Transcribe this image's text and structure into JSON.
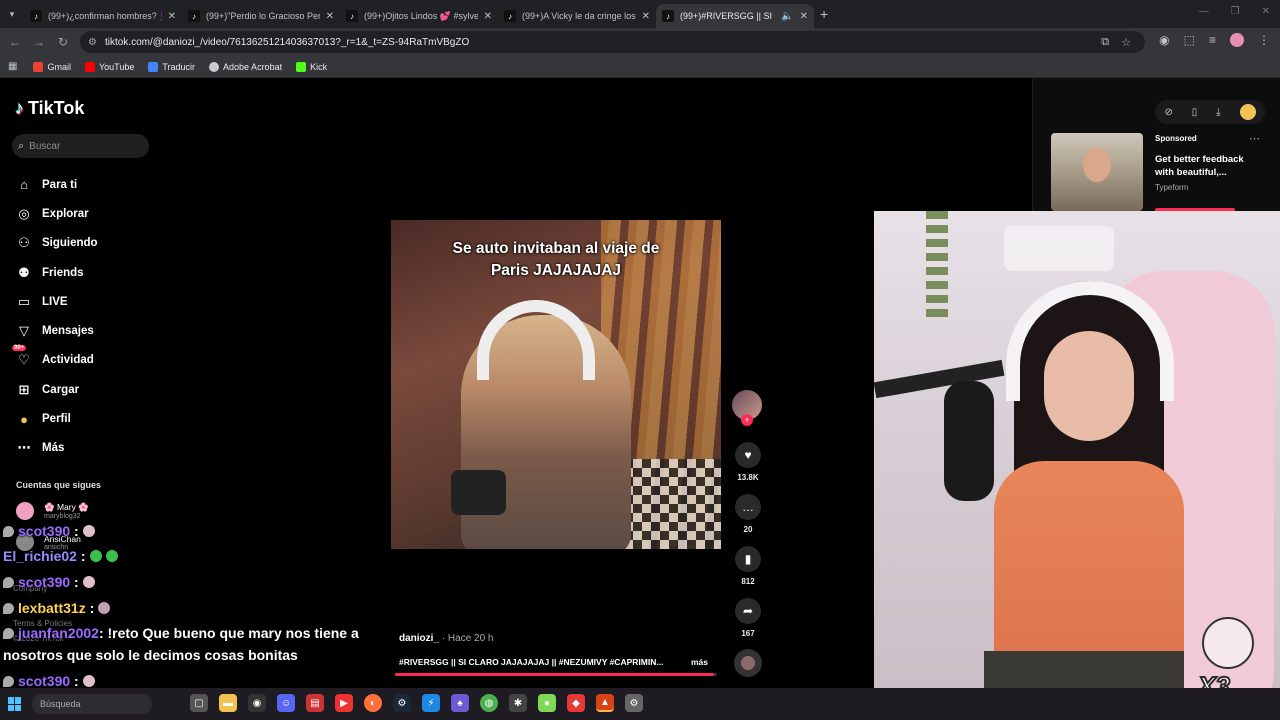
{
  "browser": {
    "tabs": [
      {
        "title": "(99+)¿confirman hombres? 🧕 ..."
      },
      {
        "title": "(99+)\"Perdio lo Gracioso Pero C..."
      },
      {
        "title": "(99+)Ojitos Lindos 💕 #sylvee..."
      },
      {
        "title": "(99+)A Vicky le da cringe los in..."
      },
      {
        "title": "(99+)#RIVERSGG || SI CLARO..."
      }
    ],
    "url": "tiktok.com/@daniozi_/video/7613625121403637013?_r=1&_t=ZS-94RaTmVBgZO",
    "bookmarks": [
      {
        "label": "Gmail",
        "color": "#ea4335"
      },
      {
        "label": "YouTube",
        "color": "#ff0000"
      },
      {
        "label": "Traducir",
        "color": "#4285f4"
      },
      {
        "label": "Adobe Acrobat",
        "color": "#cccccc"
      },
      {
        "label": "Kick",
        "color": "#53fc18"
      }
    ]
  },
  "tiktok": {
    "logo": "TikTok",
    "search_placeholder": "Buscar",
    "menu": [
      {
        "label": "Para ti",
        "icon": "home-icon"
      },
      {
        "label": "Explorar",
        "icon": "compass-icon"
      },
      {
        "label": "Siguiendo",
        "icon": "following-icon"
      },
      {
        "label": "Friends",
        "icon": "friends-icon"
      },
      {
        "label": "LIVE",
        "icon": "live-icon"
      },
      {
        "label": "Mensajes",
        "icon": "messages-icon"
      },
      {
        "label": "Actividad",
        "icon": "activity-icon",
        "badge": "99+"
      },
      {
        "label": "Cargar",
        "icon": "upload-icon"
      },
      {
        "label": "Perfil",
        "icon": "profile-icon"
      },
      {
        "label": "Más",
        "icon": "more-icon"
      }
    ],
    "following_title": "Cuentas que sigues",
    "accounts": [
      {
        "name": "🌸 Mary 🌸",
        "handle": "maryblog32"
      },
      {
        "name": "AnsiChan",
        "handle": "ansichn"
      }
    ],
    "footer": {
      "company": "Company",
      "terms": "Terms & Policies",
      "copyright": "© 2026 TikTok"
    },
    "video": {
      "caption_line1": "Se auto invitaban al viaje de",
      "caption_line2": "Paris JAJAJAJAJ",
      "author": "daniozi_",
      "time": "· Hace 20 h",
      "description": "#RIVERSGG || SI CLARO JAJAJAJAJ || #NEZUMIVY #CAPRIMIN...",
      "more": "más",
      "progress": 0.99
    },
    "actions": {
      "likes": "13.8K",
      "comments": "20",
      "saves": "812",
      "shares": "167"
    },
    "ad": {
      "sponsored": "Sponsored",
      "title": "Get better feedback with beautiful,...",
      "brand": "Typeform"
    }
  },
  "chat": [
    {
      "user": "scot390",
      "color": "#9b6bff",
      "msg": ":"
    },
    {
      "user": "El_richie02",
      "color": "#8f8fff",
      "msg": ":"
    },
    {
      "user": "scot390",
      "color": "#9b6bff",
      "msg": ":"
    },
    {
      "user": "lexbatt31z",
      "color": "#ffd34a",
      "msg": ":"
    },
    {
      "user": "juanfan2002",
      "color": "#9b6bff",
      "msg": ": !reto Que bueno que mary nos tiene a"
    },
    {
      "user": "",
      "color": "#ffffff",
      "msg": "nosotros que solo le decimos cosas bonitas"
    },
    {
      "user": "scot390",
      "color": "#9b6bff",
      "msg": ":"
    }
  ],
  "taskbar": {
    "search_label": "Búsqueda"
  },
  "colors": {
    "accent": "#fe2c55",
    "cyan": "#25f4ee"
  }
}
